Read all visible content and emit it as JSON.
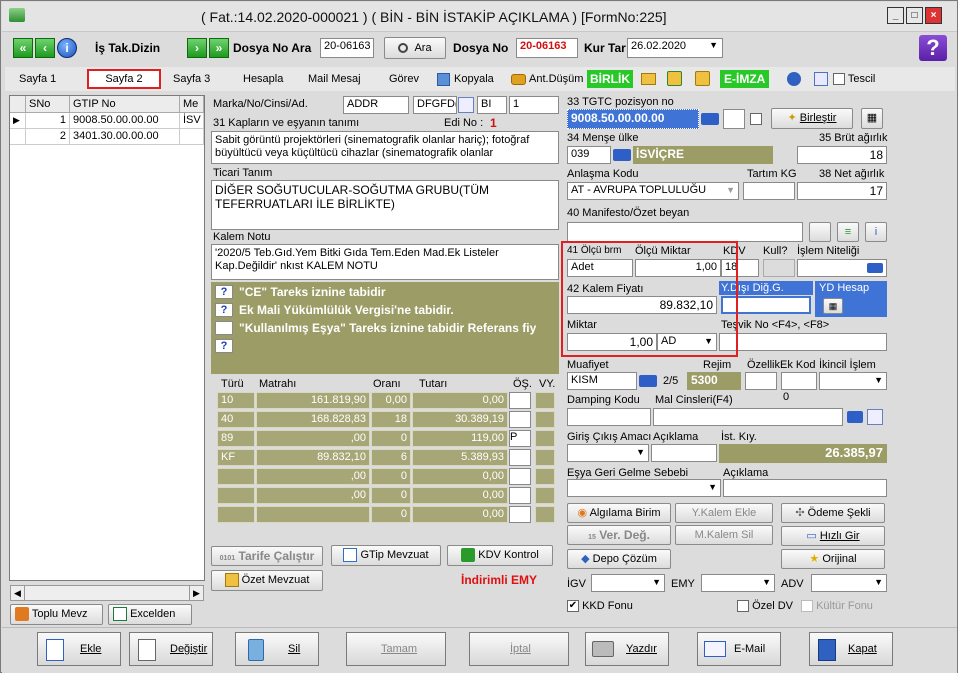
{
  "window": {
    "title": "( Fat.:14.02.2020-000021 ) ( BİN - BİN İSTAKİP AÇIKLAMA ) [FormNo:225]"
  },
  "toolbar": {
    "is_tak_dizin": "İş Tak.Dizin",
    "dosya_no_ara_label": "Dosya No Ara",
    "dosya_no_ara_value": "20-06163",
    "ara_label": "Ara",
    "dosya_no_label": "Dosya No",
    "dosya_no_value": "20-06163",
    "kur_tar_label": "Kur Tar",
    "kur_tar_value": "26.02.2020"
  },
  "tabs": [
    {
      "label": "Sayfa 1"
    },
    {
      "label": "Sayfa 2"
    },
    {
      "label": "Sayfa 3"
    },
    {
      "label": "Hesapla"
    },
    {
      "label": "Mail Mesaj"
    },
    {
      "label": "Görev"
    },
    {
      "label": "Kopyala"
    },
    {
      "label": "Ant.Düşüm"
    },
    {
      "label": "BİRLİK"
    },
    {
      "label": "E-İMZA"
    },
    {
      "label": "Tescil"
    }
  ],
  "grid": {
    "headers": [
      "SNo",
      "GTIP No",
      "Me"
    ],
    "rows": [
      {
        "sno": "1",
        "gtip": "9008.50.00.00.00",
        "me": "İSV"
      },
      {
        "sno": "2",
        "gtip": "3401.30.00.00.00",
        "me": ""
      }
    ]
  },
  "left_buttons": {
    "toplu_mevz": "Toplu Mevz",
    "excelden": "Excelden"
  },
  "form": {
    "marka_label": "Marka/No/Cinsi/Ad.",
    "marka_v1": "ADDR",
    "marka_v2": "DFGFD(",
    "marka_v3": "BI",
    "marka_v4": "1",
    "kaplar_label": "31 Kapların ve eşyanın tanımı",
    "edi_no_label": "Edi No :",
    "edi_no_value": "1",
    "kaplar_text": "Sabit görüntü projektörleri (sinematografik olanlar hariç); fotoğraf büyültücü veya küçültücü cihazlar (sinematografik olanlar",
    "ticari_label": "Ticari Tanım",
    "ticari_text": "DİĞER SOĞUTUCULAR-SOĞUTMA GRUBU(TÜM TEFERRUATLARI İLE BİRLİKTE)",
    "kalem_notu_label": "Kalem Notu",
    "kalem_notu_text": "'2020/5 Teb.Gıd.Yem Bitki Gıda Tem.Eden Mad.Ek Listeler Kap.Değildir' nkıst KALEM NOTU",
    "notices": [
      {
        "q": "?",
        "text": "\"CE\" Tareks iznine tabidir"
      },
      {
        "q": "?",
        "text": "Ek Mali Yükümlülük Vergisi'ne tabidir."
      },
      {
        "q": "",
        "text": "\"Kullanılmış Eşya\" Tareks iznine tabidir Referans fiy"
      },
      {
        "q": "?",
        "text": ""
      }
    ]
  },
  "tax_table": {
    "headers": [
      "Türü",
      "Matrahı",
      "Oranı",
      "Tutarı",
      "ÖŞ.",
      "VY."
    ],
    "rows": [
      {
        "turu": "10",
        "matrah": "161.819,90",
        "oran": "0,00",
        "tutar": "0,00",
        "os": ""
      },
      {
        "turu": "40",
        "matrah": "168.828,83",
        "oran": "18",
        "tutar": "30.389,19",
        "os": ""
      },
      {
        "turu": "89",
        "matrah": ",00",
        "oran": "0",
        "tutar": "119,00",
        "os": "P"
      },
      {
        "turu": "KF",
        "matrah": "89.832,10",
        "oran": "6",
        "tutar": "5.389,93",
        "os": ""
      },
      {
        "turu": "",
        "matrah": ",00",
        "oran": "0",
        "tutar": "0,00",
        "os": ""
      },
      {
        "turu": "",
        "matrah": ",00",
        "oran": "0",
        "tutar": "0,00",
        "os": ""
      },
      {
        "turu": "",
        "matrah": "",
        "oran": "0",
        "tutar": "0,00",
        "os": ""
      }
    ]
  },
  "lower_buttons": {
    "tarife": "Tarife Çalıştır",
    "gtip_mevzuat": "GTip Mevzuat",
    "kdv_kontrol": "KDV Kontrol",
    "ozet_mevzuat": "Özet Mevzuat",
    "indirimli": "İndirimli EMY"
  },
  "right": {
    "tgtc_label": "33 TGTC pozisyon no",
    "tgtc_value": "9008.50.00.00.00",
    "birlestir": "Birleştir",
    "mense_label": "34 Menşe ülke",
    "brut_label": "35 Brüt ağırlık",
    "mense_code": "039",
    "mense_name": "İSVİÇRE",
    "brut_value": "18",
    "anlasma_label": "Anlaşma Kodu",
    "tartim_label": "Tartım KG",
    "net_label": "38 Net ağırlık",
    "anlasma_value": "AT  - AVRUPA TOPLULUĞU",
    "net_value": "17",
    "manifesto_label": "40 Manifesto/Özet beyan",
    "olcu_brm_label": "41 Ölçü brm",
    "olcu_miktar_label": "Ölçü Miktar",
    "kdv_label": "KDV",
    "kull_label": "Kull?",
    "islem_niteligi_label": "İşlem Niteliği",
    "olcu_brm_value": "Adet",
    "olcu_miktar_value": "1,00",
    "kdv_value": "18",
    "kalem_fiyati_label": "42 Kalem Fiyatı",
    "ydisi_label": "Y.Dışı Diğ.G.",
    "yd_hesap_label": "YD Hesap",
    "kalem_fiyati_value": "89.832,10",
    "miktar_label": "Miktar",
    "tesvik_label": "Teşvik No <F4>, <F8>",
    "miktar_value": "1,00",
    "miktar_unit": "AD",
    "muafiyet_label": "Muafiyet",
    "rejim_label": "Rejim",
    "ozellik_label": "Özellik",
    "ek_kod_label": "Ek Kod",
    "ikincil_label": "İkincil İşlem",
    "muafiyet_value": "KISM",
    "muafiyet_frac": "2/5",
    "rejim_value": "5300",
    "damping_label": "Damping Kodu",
    "mal_cinsleri_label": "Mal Cinsleri(F4)",
    "damping_zero": "0",
    "giris_label": "Giriş Çıkış Amacı",
    "aciklama_label": "Açıklama",
    "ist_kiy_label": "İst. Kıy.",
    "ist_kiy_value": "26.385,97",
    "esya_label": "Eşya Geri Gelme Sebebi",
    "aciklama2_label": "Açıklama",
    "algilama": "Algılama Birim",
    "kalem_ekle": "Y.Kalem Ekle",
    "odeme_sekli": "Ödeme Şekli",
    "ver_deg": "Ver. Değ.",
    "m_kalem_sil": "M.Kalem Sil",
    "hizli_gir": "Hızlı Gir",
    "depo_cozum": "Depo Çözüm",
    "orijinal": "Orijinal",
    "igv_label": "İGV",
    "emy_label": "EMY",
    "adv_label": "ADV",
    "kkd_label": "KKD Fonu",
    "ozel_dv_label": "Özel DV",
    "kultur_label": "Kültür Fonu"
  },
  "bottom": {
    "ekle": "Ekle",
    "degistir": "Değiştir",
    "sil": "Sil",
    "tamam": "Tamam",
    "iptal": "İptal",
    "yazdir": "Yazdır",
    "email": "E-Mail",
    "kapat": "Kapat"
  }
}
